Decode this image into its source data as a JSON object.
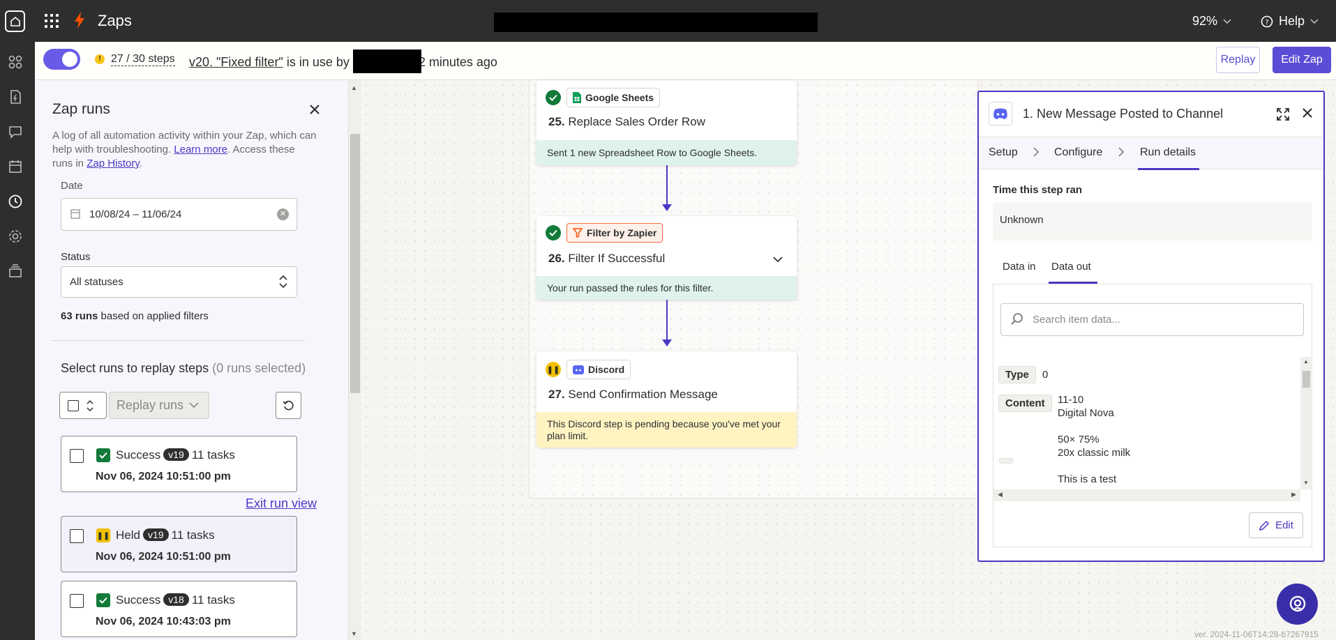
{
  "topbar": {
    "title": "Zaps",
    "zoom": "92%",
    "help": "Help"
  },
  "subbar": {
    "steps": "27 / 30 steps",
    "version_link": "v20. \"Fixed filter\"",
    "in_use_text": " is in use by ",
    "ago_text": "2 minutes ago",
    "replay_label": "Replay",
    "edit_label": "Edit Zap"
  },
  "runs_panel": {
    "title": "Zap runs",
    "desc_pre": "A log of all automation activity within your Zap, which can help with troubleshooting. ",
    "learn_more": "Learn more",
    "desc_mid": ". Access these runs in ",
    "history_link": "Zap History",
    "desc_end": ".",
    "date_label": "Date",
    "date_value": "10/08/24 – 11/06/24",
    "status_label": "Status",
    "status_value": "All statuses",
    "count_bold": "63 runs",
    "count_rest": " based on applied filters",
    "select_title": "Select runs to replay steps",
    "select_count": "(0 runs selected)",
    "replay_runs": "Replay runs",
    "exit_link": "Exit run view",
    "runs": [
      {
        "status": "Success",
        "version": "v19",
        "tasks": "11 tasks",
        "time": "Nov 06, 2024 10:51:00 pm"
      },
      {
        "status": "Held",
        "version": "v19",
        "tasks": "11 tasks",
        "time": "Nov 06, 2024 10:51:00 pm"
      },
      {
        "status": "Success",
        "version": "v18",
        "tasks": "11 tasks",
        "time": "Nov 06, 2024 10:43:03 pm"
      }
    ]
  },
  "steps": [
    {
      "app": "Google Sheets",
      "num": "25.",
      "name": "Replace Sales Order Row",
      "footer": "Sent 1 new Spreadsheet Row to Google Sheets."
    },
    {
      "app": "Filter by Zapier",
      "num": "26.",
      "name": "Filter If Successful",
      "footer": "Your run passed the rules for this filter."
    },
    {
      "app": "Discord",
      "num": "27.",
      "name": "Send Confirmation Message",
      "footer": "This Discord step is pending because you've met your plan limit."
    }
  ],
  "details": {
    "title": "1.  New Message Posted to Channel",
    "tabs": [
      "Setup",
      "Configure",
      "Run details"
    ],
    "time_label": "Time this step ran",
    "time_value": "Unknown",
    "io_tabs": [
      "Data in",
      "Data out"
    ],
    "search_placeholder": "Search item data...",
    "fields": [
      {
        "key": "Type",
        "value": "0"
      },
      {
        "key": "Content",
        "value": "11-10\nDigital Nova\n\n50× 75%\n20x classic milk\n\nThis is a test"
      }
    ],
    "edit_label": "Edit"
  },
  "version": "ver. 2024-11-06T14:28-b7267915",
  "colors": {
    "accent": "#4938c4",
    "success": "#137a3a",
    "held": "#f2c000",
    "zapier_orange": "#ff4f00"
  }
}
